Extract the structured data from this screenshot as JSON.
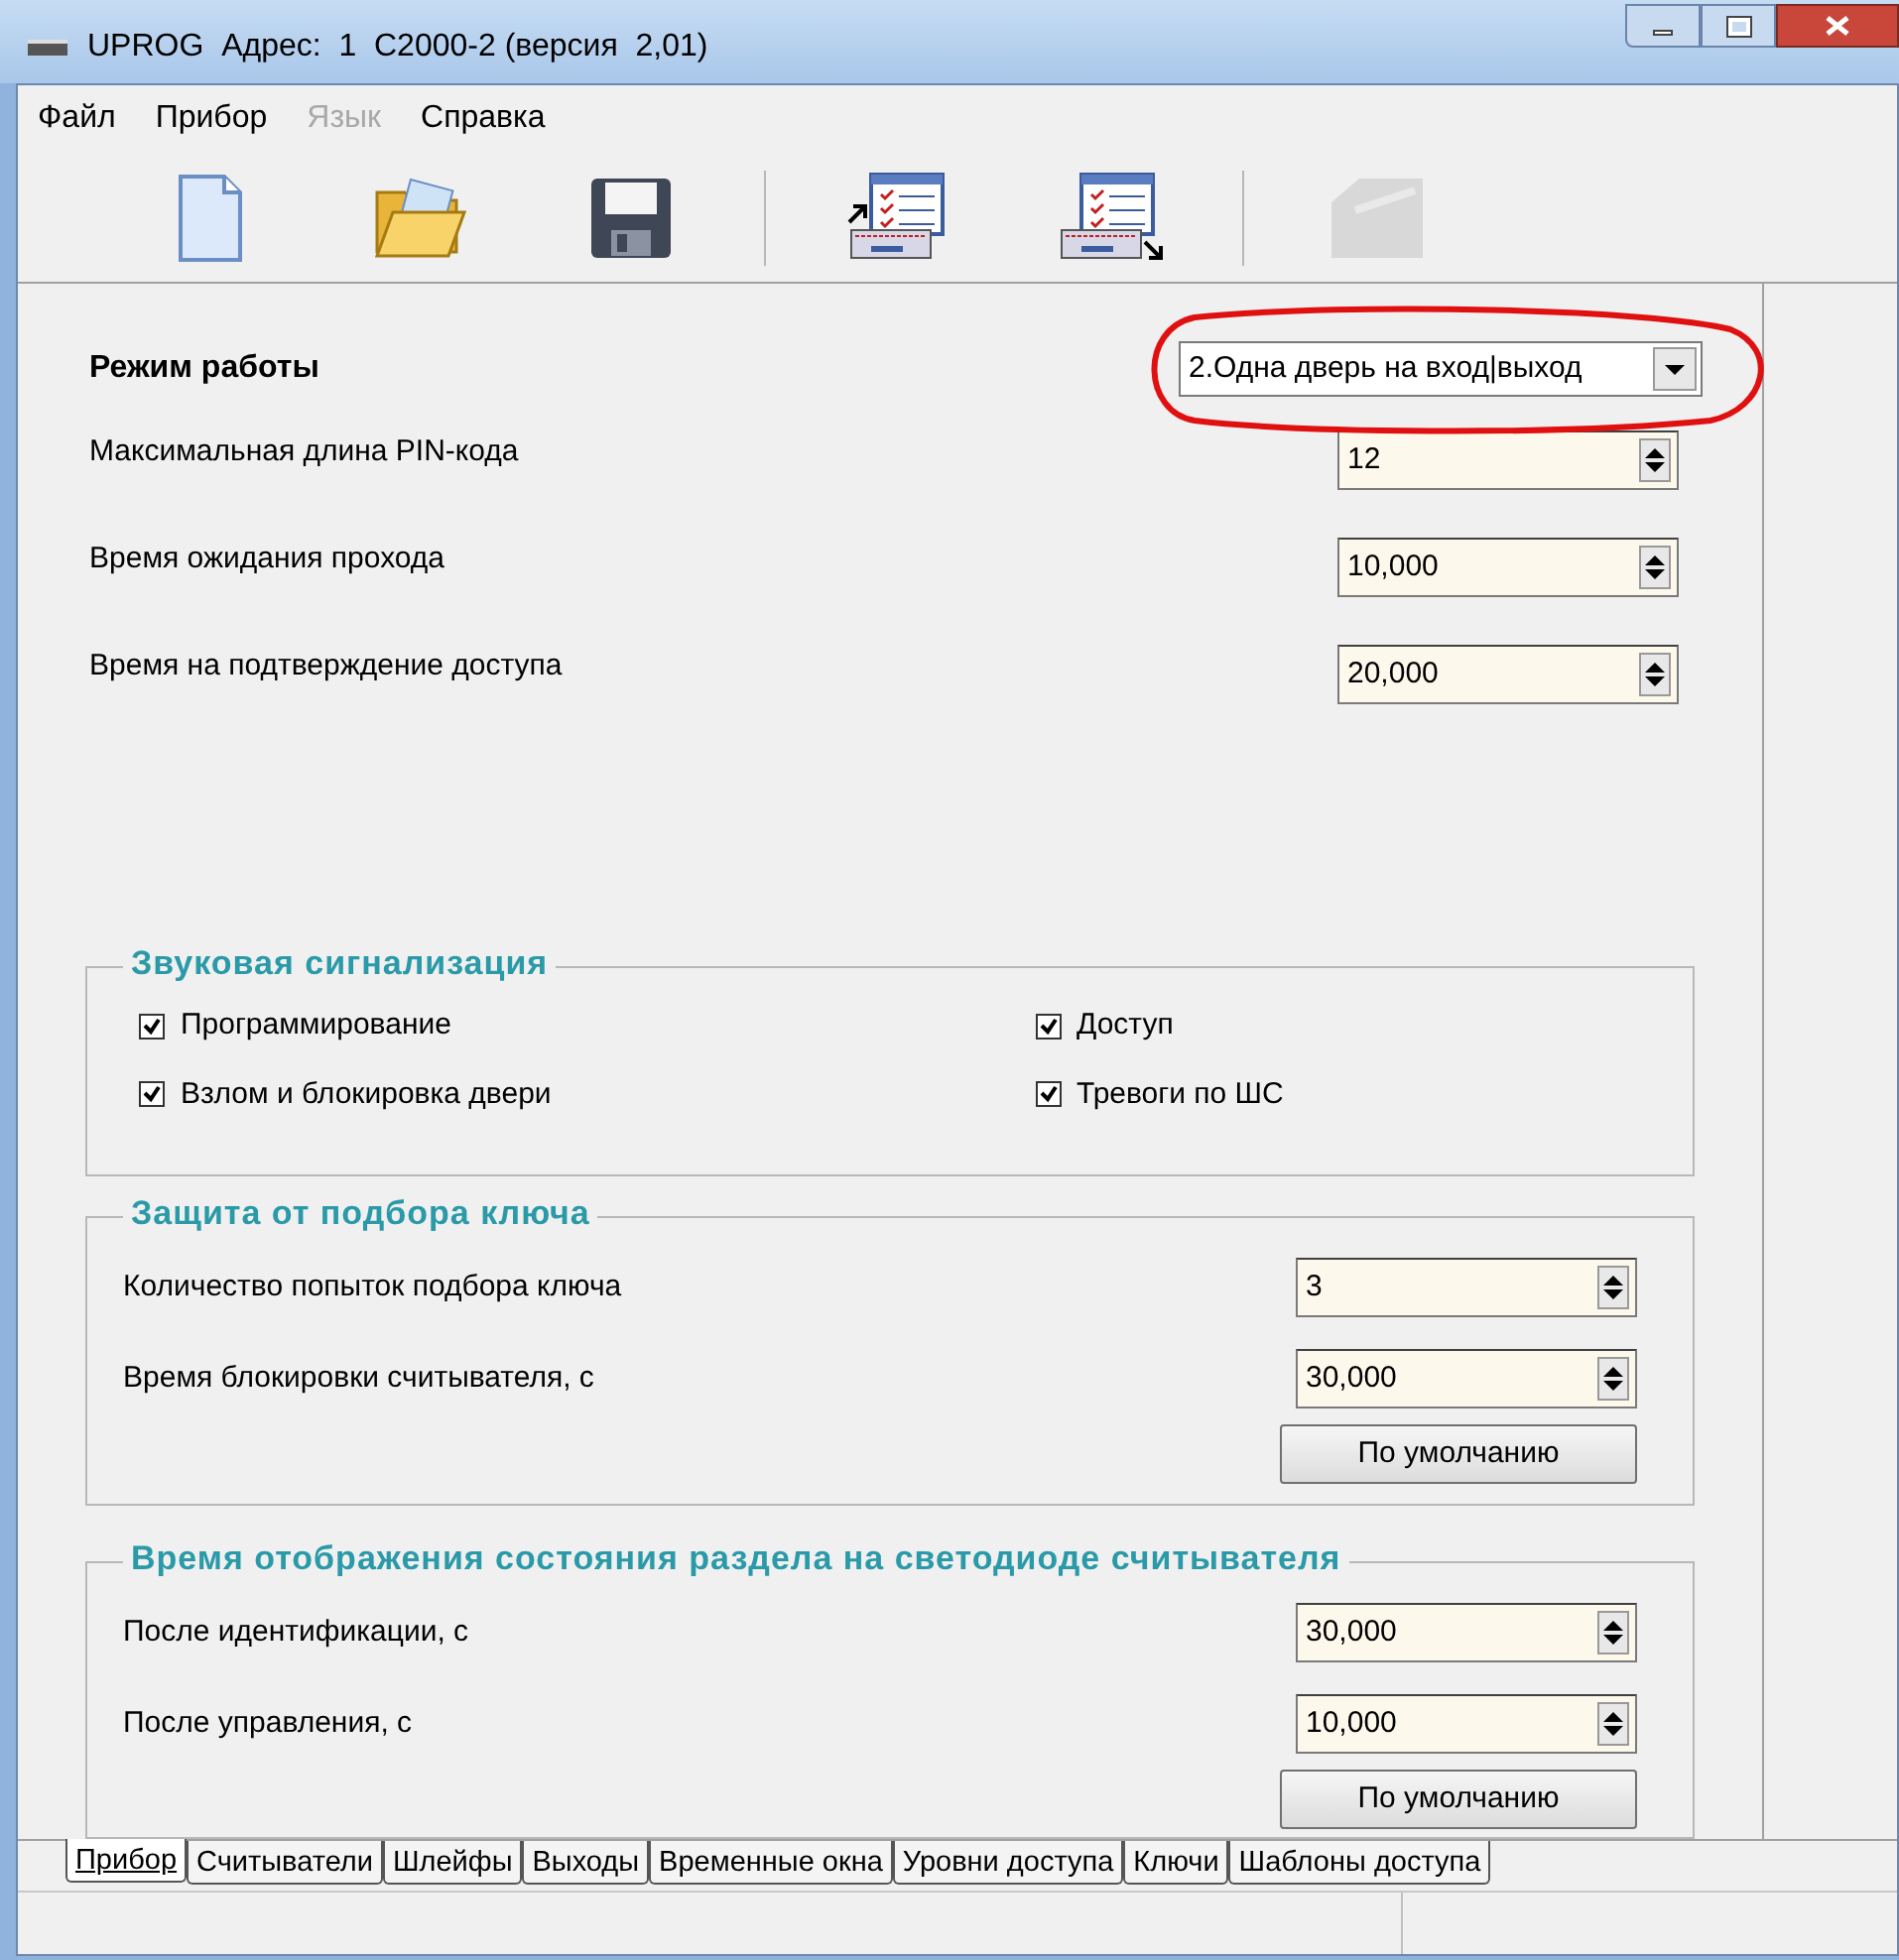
{
  "window": {
    "title": "UPROG  Адрес:  1  С2000-2 (версия  2,01)"
  },
  "menu": [
    {
      "label": "Файл",
      "disabled": false
    },
    {
      "label": "Прибор",
      "disabled": false
    },
    {
      "label": "Язык",
      "disabled": true
    },
    {
      "label": "Справка",
      "disabled": false
    }
  ],
  "toolbar": [
    {
      "kind": "new",
      "disabled": false
    },
    {
      "kind": "open",
      "disabled": false
    },
    {
      "kind": "save",
      "disabled": false
    },
    {
      "kind": "separator"
    },
    {
      "kind": "read",
      "disabled": false
    },
    {
      "kind": "write",
      "disabled": false
    },
    {
      "kind": "separator"
    },
    {
      "kind": "device",
      "disabled": true
    }
  ],
  "mode": {
    "label": "Режим работы",
    "value": "2.Одна дверь на вход|выход",
    "highlighted": true
  },
  "fields": [
    {
      "label": "Максимальная длина PIN-кода",
      "value": "12"
    },
    {
      "label": "Время ожидания прохода",
      "value": "10,000"
    },
    {
      "label": "Время на подтверждение доступа",
      "value": "20,000"
    }
  ],
  "sound": {
    "title": "Звуковая сигнализация",
    "options": [
      {
        "label": "Программирование",
        "checked": true
      },
      {
        "label": "Доступ",
        "checked": true
      },
      {
        "label": "Взлом и блокировка двери",
        "checked": true
      },
      {
        "label": "Тревоги по ШС",
        "checked": true
      }
    ]
  },
  "key_protection": {
    "title": "Защита от подбора ключа",
    "fields": [
      {
        "label": "Количество попыток подбора ключа",
        "value": "3"
      },
      {
        "label": "Время блокировки считывателя, с",
        "value": "30,000"
      }
    ],
    "button": "По умолчанию"
  },
  "led_display": {
    "title": "Время отображения состояния раздела на светодиоде считывателя",
    "fields": [
      {
        "label": "После идентификации, с",
        "value": "30,000"
      },
      {
        "label": "После управления, с",
        "value": "10,000"
      }
    ],
    "button": "По умолчанию"
  },
  "tabs": [
    {
      "label": "Прибор",
      "selected": true
    },
    {
      "label": "Считыватели",
      "selected": false
    },
    {
      "label": "Шлейфы",
      "selected": false
    },
    {
      "label": "Выходы",
      "selected": false
    },
    {
      "label": "Временные окна",
      "selected": false
    },
    {
      "label": "Уровни доступа",
      "selected": false
    },
    {
      "label": "Ключи",
      "selected": false
    },
    {
      "label": "Шаблоны доступа",
      "selected": false
    }
  ]
}
